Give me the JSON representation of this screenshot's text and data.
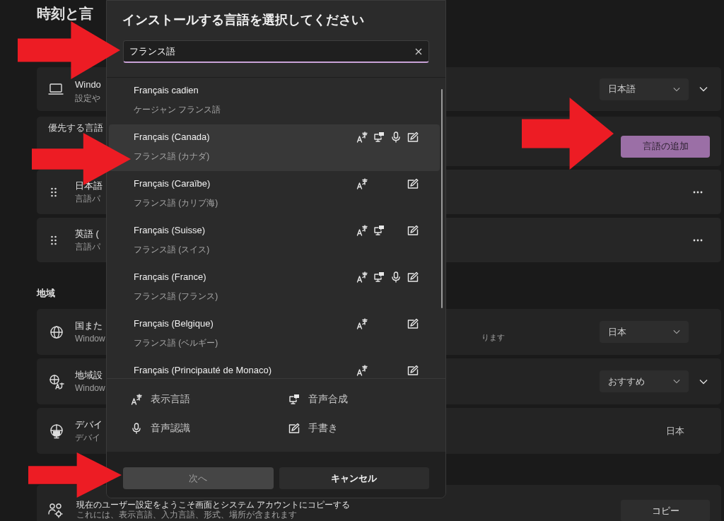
{
  "page": {
    "title": "時刻と言"
  },
  "language_section": {
    "display_row": {
      "title": "Windo",
      "subtitle": "設定や",
      "dropdown": "日本語",
      "expanded": false
    },
    "preferred_header": "優先する言語",
    "add_button": "言語の追加",
    "languages": [
      {
        "name": "日本語",
        "subtitle": "言語パ"
      },
      {
        "name": "英語 (",
        "subtitle": "言語パ"
      }
    ]
  },
  "region_section": {
    "header": "地域",
    "rows": [
      {
        "kind": "dropdown",
        "title": "国また",
        "subtitle": "Window",
        "note": "ります",
        "value": "日本"
      },
      {
        "kind": "dropdown-expand",
        "title": "地域設",
        "subtitle": "Window",
        "value": "おすすめ",
        "expanded": false
      },
      {
        "kind": "text",
        "title": "デバイ",
        "subtitle": "デバイ",
        "value": "日本"
      }
    ]
  },
  "copy_row": {
    "title": "現在のユーザー設定をようこそ画面とシステム アカウントにコピーする",
    "subtitle": "これには、表示言語、入力言語、形式、場所が含まれます",
    "button": "コピー"
  },
  "dialog": {
    "title": "インストールする言語を選択してください",
    "search": {
      "value": "フランス語"
    },
    "languages": [
      {
        "name": "Français cadien",
        "native": "ケージャン フランス語",
        "selected": false,
        "display": false,
        "tts": false,
        "speech": false,
        "handwriting": false
      },
      {
        "name": "Français (Canada)",
        "native": "フランス語 (カナダ)",
        "selected": true,
        "display": true,
        "tts": true,
        "speech": true,
        "handwriting": true
      },
      {
        "name": "Français (Caraïbe)",
        "native": "フランス語 (カリブ海)",
        "selected": false,
        "display": true,
        "tts": false,
        "speech": false,
        "handwriting": true
      },
      {
        "name": "Français (Suisse)",
        "native": "フランス語 (スイス)",
        "selected": false,
        "display": true,
        "tts": true,
        "speech": false,
        "handwriting": true
      },
      {
        "name": "Français (France)",
        "native": "フランス語 (フランス)",
        "selected": false,
        "display": true,
        "tts": true,
        "speech": true,
        "handwriting": true
      },
      {
        "name": "Français (Belgique)",
        "native": "フランス語 (ベルギー)",
        "selected": false,
        "display": true,
        "tts": false,
        "speech": false,
        "handwriting": true
      },
      {
        "name": "Français (Principauté de Monaco)",
        "selected": false,
        "display": true,
        "tts": false,
        "speech": false,
        "handwriting": true
      }
    ],
    "legend": [
      {
        "kind": "display",
        "label": "表示言語"
      },
      {
        "kind": "tts",
        "label": "音声合成"
      },
      {
        "kind": "speech",
        "label": "音声認識"
      },
      {
        "kind": "handwriting",
        "label": "手書き"
      }
    ],
    "buttons": [
      {
        "label": "次へ",
        "disabled": true
      },
      {
        "label": "キャンセル",
        "disabled": false
      }
    ]
  }
}
